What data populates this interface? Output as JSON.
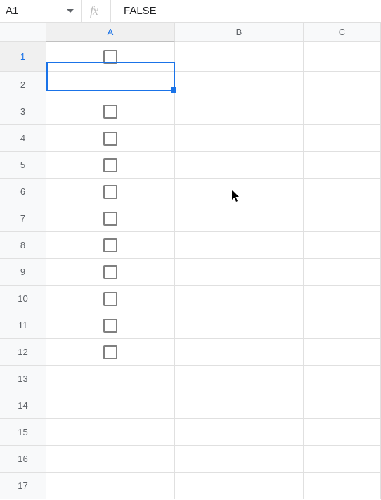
{
  "formulaBar": {
    "cellRef": "A1",
    "fxLabel": "fx",
    "formulaValue": "FALSE"
  },
  "columns": [
    {
      "label": "A",
      "selected": true
    },
    {
      "label": "B",
      "selected": false
    },
    {
      "label": "C",
      "selected": false
    }
  ],
  "rows": [
    {
      "num": "1",
      "selected": true,
      "tall": true,
      "hasCheckbox": true
    },
    {
      "num": "2",
      "selected": false,
      "tall": false,
      "hasCheckbox": false
    },
    {
      "num": "3",
      "selected": false,
      "tall": false,
      "hasCheckbox": true
    },
    {
      "num": "4",
      "selected": false,
      "tall": false,
      "hasCheckbox": true
    },
    {
      "num": "5",
      "selected": false,
      "tall": false,
      "hasCheckbox": true
    },
    {
      "num": "6",
      "selected": false,
      "tall": false,
      "hasCheckbox": true
    },
    {
      "num": "7",
      "selected": false,
      "tall": false,
      "hasCheckbox": true
    },
    {
      "num": "8",
      "selected": false,
      "tall": false,
      "hasCheckbox": true
    },
    {
      "num": "9",
      "selected": false,
      "tall": false,
      "hasCheckbox": true
    },
    {
      "num": "10",
      "selected": false,
      "tall": false,
      "hasCheckbox": true
    },
    {
      "num": "11",
      "selected": false,
      "tall": false,
      "hasCheckbox": true
    },
    {
      "num": "12",
      "selected": false,
      "tall": false,
      "hasCheckbox": true
    },
    {
      "num": "13",
      "selected": false,
      "tall": false,
      "hasCheckbox": false
    },
    {
      "num": "14",
      "selected": false,
      "tall": false,
      "hasCheckbox": false
    },
    {
      "num": "15",
      "selected": false,
      "tall": false,
      "hasCheckbox": false
    },
    {
      "num": "16",
      "selected": false,
      "tall": false,
      "hasCheckbox": false
    },
    {
      "num": "17",
      "selected": false,
      "tall": false,
      "hasCheckbox": false
    }
  ]
}
